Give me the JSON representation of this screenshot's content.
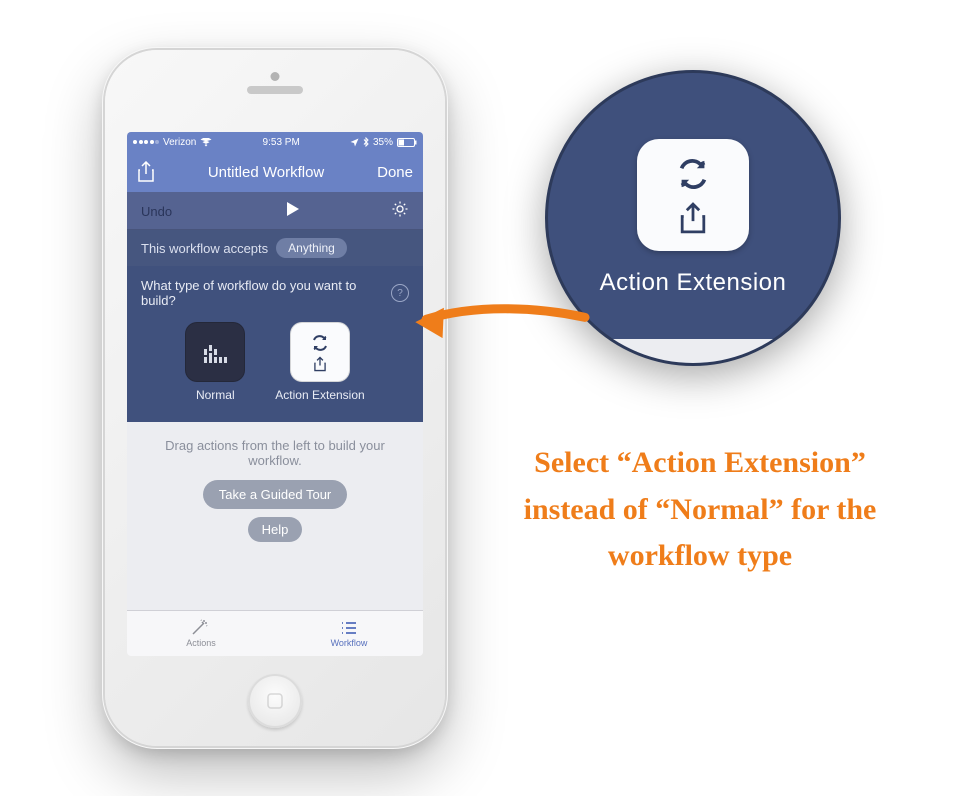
{
  "statusbar": {
    "carrier": "Verizon",
    "time": "9:53 PM",
    "battery": "35%"
  },
  "navbar": {
    "title": "Untitled Workflow",
    "done": "Done"
  },
  "controls": {
    "undo": "Undo"
  },
  "accepts": {
    "label": "This workflow accepts",
    "value": "Anything"
  },
  "question": "What type of workflow do you want to build?",
  "choices": {
    "normal": "Normal",
    "action_extension": "Action Extension"
  },
  "hint": "Drag actions from the left to build your workflow.",
  "buttons": {
    "tour": "Take a Guided Tour",
    "help": "Help"
  },
  "tabs": {
    "actions": "Actions",
    "workflow": "Workflow"
  },
  "zoom": {
    "label": "Action Extension"
  },
  "caption": "Select “Action Extension” instead of “Normal” for the workflow type"
}
